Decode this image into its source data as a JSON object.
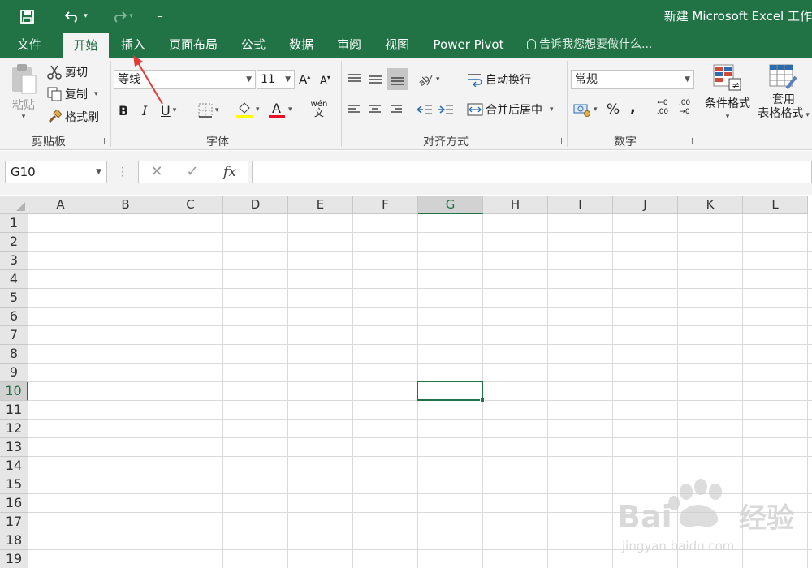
{
  "window": {
    "title": "新建 Microsoft Excel 工作"
  },
  "quick_access": {
    "save_icon": "save-icon",
    "undo_icon": "undo-icon",
    "redo_icon": "redo-icon",
    "customize_icon": "customize-qat-icon"
  },
  "tabs": [
    {
      "label": "文件"
    },
    {
      "label": "开始"
    },
    {
      "label": "插入"
    },
    {
      "label": "页面布局"
    },
    {
      "label": "公式"
    },
    {
      "label": "数据"
    },
    {
      "label": "审阅"
    },
    {
      "label": "视图"
    },
    {
      "label": "Power Pivot"
    }
  ],
  "active_tab": "开始",
  "tell_me": "告诉我您想要做什么...",
  "ribbon": {
    "clipboard": {
      "group_label": "剪贴板",
      "paste": "粘贴",
      "cut": "剪切",
      "copy": "复制",
      "format_painter": "格式刷"
    },
    "font": {
      "group_label": "字体",
      "font_name": "等线",
      "font_size": "11",
      "bold": "B",
      "italic": "I",
      "underline": "U",
      "phonetic_top": "wén",
      "phonetic_bottom": "文"
    },
    "alignment": {
      "group_label": "对齐方式",
      "wrap_text": "自动换行",
      "merge_center": "合并后居中"
    },
    "number": {
      "group_label": "数字",
      "format": "常规",
      "percent": "%",
      "comma": ",",
      "inc_decimal_top": "←0",
      "inc_decimal_bottom": ".00",
      "dec_decimal_top": ".00",
      "dec_decimal_bottom": "→0"
    },
    "styles": {
      "conditional_format": "条件格式",
      "table_format_line1": "套用",
      "table_format_line2": "表格格式"
    }
  },
  "formula_bar": {
    "name_box": "G10",
    "cancel": "✕",
    "enter": "✓",
    "fx": "fx",
    "content": ""
  },
  "grid": {
    "columns": [
      "A",
      "B",
      "C",
      "D",
      "E",
      "F",
      "G",
      "H",
      "I",
      "J",
      "K",
      "L"
    ],
    "rows": [
      "1",
      "2",
      "3",
      "4",
      "5",
      "6",
      "7",
      "8",
      "9",
      "10",
      "11",
      "12",
      "13",
      "14",
      "15",
      "16",
      "17",
      "18",
      "19"
    ],
    "active_column": "G",
    "active_row": "10"
  },
  "colors": {
    "accent": "#217346",
    "font_color_bar": "#e81123",
    "fill_color_bar": "#ffff00",
    "annotation_arrow": "#e53935"
  },
  "watermark": {
    "text": "Baidu 经验",
    "subtext": "jingyan.baidu.com"
  }
}
